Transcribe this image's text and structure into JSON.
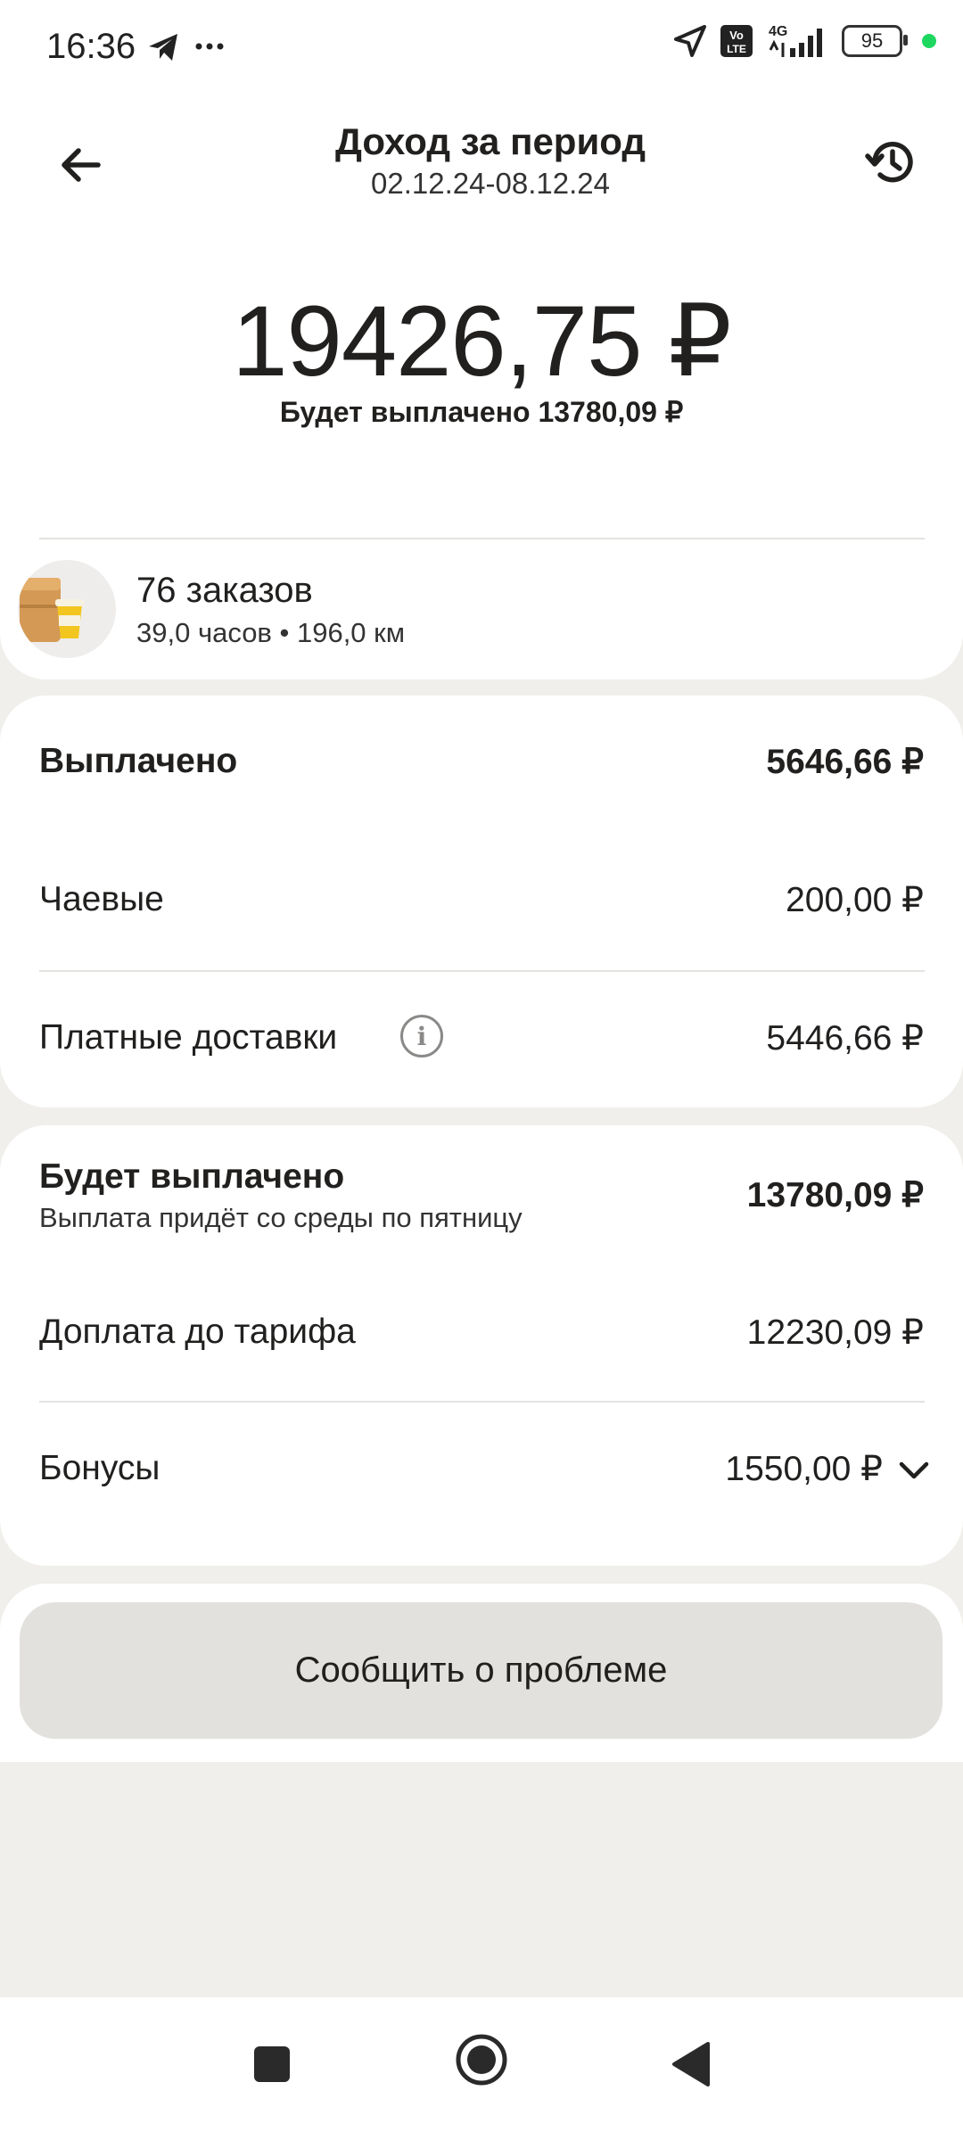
{
  "status_bar": {
    "time": "16:36",
    "icons_left": [
      "telegram-icon",
      "more-icon"
    ],
    "icons_right": [
      "location-arrow-icon",
      "volte-icon",
      "signal-4g-icon"
    ],
    "battery": "95",
    "network": "4G"
  },
  "header": {
    "title": "Доход за период",
    "period": "02.12.24-08.12.24"
  },
  "summary": {
    "total": "19426,75 ₽",
    "payout_note": "Будет выплачено 13780,09 ₽"
  },
  "orders": {
    "count_label": "76 заказов",
    "meta": "39,0 часов • 196,0 км"
  },
  "paid_section": {
    "title": "Выплачено",
    "total": "5646,66 ₽",
    "rows": [
      {
        "label": "Чаевые",
        "value": "200,00 ₽"
      },
      {
        "label": "Платные доставки",
        "value": "5446,66 ₽"
      }
    ]
  },
  "pending_section": {
    "title": "Будет выплачено",
    "subtitle": "Выплата придёт со среды по пятницу",
    "total": "13780,09 ₽",
    "rows": [
      {
        "label": "Доплата до тарифа",
        "value": "12230,09 ₽"
      },
      {
        "label": "Бонусы",
        "value": "1550,00 ₽"
      }
    ]
  },
  "actions": {
    "report_problem": "Сообщить о проблеме"
  },
  "colors": {
    "background": "#f0efec",
    "card": "#ffffff",
    "button": "#e2e1dd",
    "text": "#21201f",
    "status_dot": "#1ed760"
  }
}
